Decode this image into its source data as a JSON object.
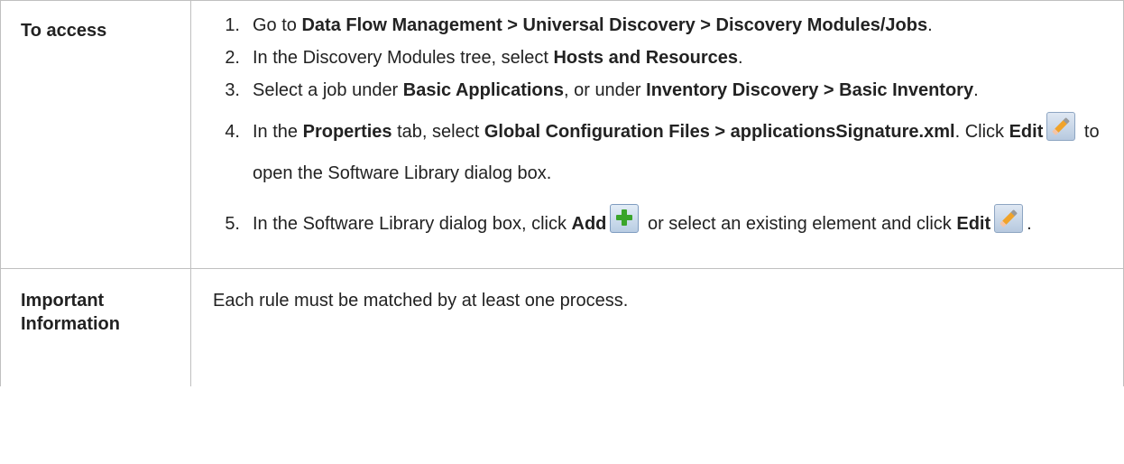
{
  "rows": {
    "access": {
      "label": "To access",
      "steps": [
        {
          "num": "1.",
          "t1": "Go to ",
          "b1": "Data Flow Management > Universal Discovery > Discovery Modules/Jobs",
          "t2": "."
        },
        {
          "num": "2.",
          "t1": "In the Discovery Modules tree, select ",
          "b1": "Hosts and Resources",
          "t2": "."
        },
        {
          "num": "3.",
          "t1": "Select a job under ",
          "b1": "Basic Applications",
          "t2": ", or under ",
          "b2": "Inventory Discovery > Basic Inventory",
          "t3": "."
        },
        {
          "num": "4.",
          "t1": "In the ",
          "b1": "Properties",
          "t2": " tab, select ",
          "b2": "Global Configuration Files > applicationsSignature.xml",
          "t3": ". Click ",
          "b3": "Edit",
          "t4": " to open the Software Library dialog box."
        },
        {
          "num": "5.",
          "t1": "In the Software Library dialog box, click ",
          "b1": "Add",
          "t2": " or select an existing element and click ",
          "b2": "Edit",
          "t3": "."
        }
      ]
    },
    "important": {
      "label": "Important Information",
      "text": "Each rule must be matched by at least one process."
    }
  },
  "icons": {
    "edit": "edit-pencil-icon",
    "add": "add-plus-icon"
  }
}
